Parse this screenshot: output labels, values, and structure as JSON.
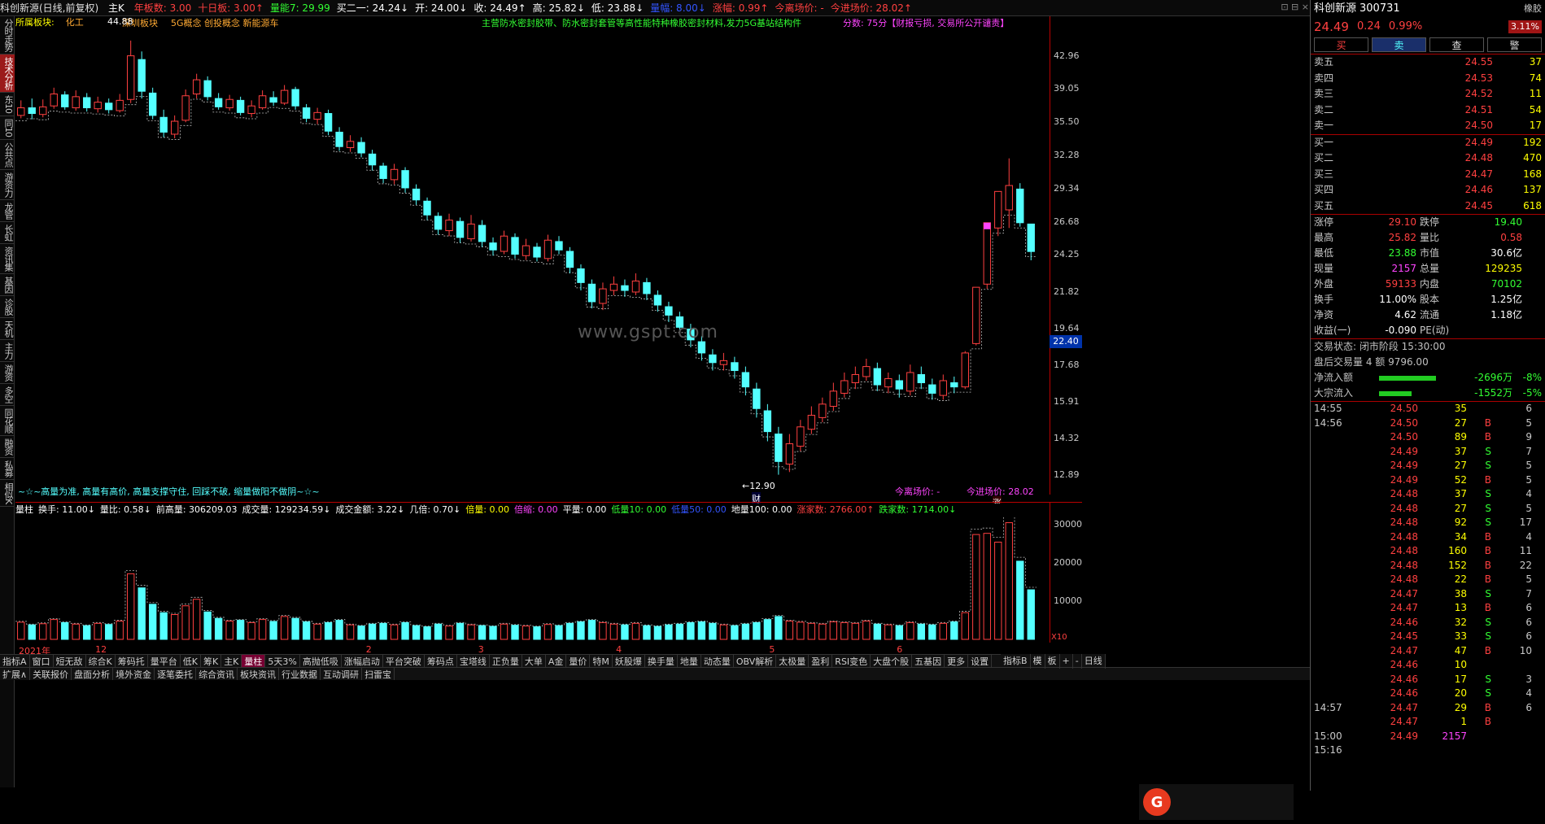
{
  "topbar": {
    "title": "科创新源(日线,前复权)",
    "main": "主K",
    "items": [
      {
        "t": "年板数: 3.00",
        "c": "red"
      },
      {
        "t": "十日板: 3.00↑",
        "c": "red"
      },
      {
        "t": "量能7: 29.99",
        "c": "grn"
      },
      {
        "t": "买二一: 24.24↓",
        "c": "white"
      },
      {
        "t": "开: 24.00↓",
        "c": "white"
      },
      {
        "t": "收: 24.49↑",
        "c": "white"
      },
      {
        "t": "高: 25.82↓",
        "c": "white"
      },
      {
        "t": "低: 23.88↓",
        "c": "white"
      },
      {
        "t": "量幅: 8.00↓",
        "c": "blue"
      },
      {
        "t": "涨幅: 0.99↑",
        "c": "red"
      },
      {
        "t": "今离场价: -",
        "c": "red"
      },
      {
        "t": "今进场价: 28.02↑",
        "c": "red"
      }
    ]
  },
  "infoline": {
    "sector_label": "所属板块:",
    "sectors": "化工",
    "sector2": "深圳板块",
    "concepts": "5G概念 创投概念 新能源车",
    "business": "主营防水密封胶带、防水密封套管等高性能特种橡胶密封材料,发力5G基站结构件",
    "score": "分数: 75分【财报亏损, 交易所公开谴责】",
    "peak_label": "44.88"
  },
  "price_ticks": [
    "42.96",
    "39.05",
    "35.50",
    "32.28",
    "29.34",
    "26.68",
    "24.25",
    "21.82",
    "19.64",
    "17.68",
    "15.91",
    "14.32",
    "12.89"
  ],
  "current_price_tag": "22.40",
  "low_label": "←12.90",
  "cai": "财",
  "zhang": "涨",
  "left_note": "~☆~高量为准, 高量有高价, 高量支撑守住, 回踩不破, 缩量做阳不做阴~☆~",
  "exit_label": "今离场价: -",
  "entry_label": "今进场价: 28.02",
  "watermark": "www.gspt.com",
  "volbar": [
    {
      "t": "量柱",
      "c": "white"
    },
    {
      "t": "换手: 11.00↓",
      "c": "white"
    },
    {
      "t": "量比: 0.58↓",
      "c": "white"
    },
    {
      "t": "前高量: 306209.03",
      "c": "white"
    },
    {
      "t": "成交量: 129234.59↓",
      "c": "white"
    },
    {
      "t": "成交金额: 3.22↓",
      "c": "white"
    },
    {
      "t": "几倍: 0.70↓",
      "c": "white"
    },
    {
      "t": "倍量: 0.00",
      "c": "yel"
    },
    {
      "t": "倍缩: 0.00",
      "c": "mag"
    },
    {
      "t": "平量: 0.00",
      "c": "white"
    },
    {
      "t": "低量10: 0.00",
      "c": "grn"
    },
    {
      "t": "低量50: 0.00",
      "c": "blue"
    },
    {
      "t": "地量100: 0.00",
      "c": "white"
    },
    {
      "t": "涨家数: 2766.00↑",
      "c": "red"
    },
    {
      "t": "跌家数: 1714.00↓",
      "c": "grn"
    }
  ],
  "vol_ticks": [
    "30000",
    "20000",
    "10000"
  ],
  "vol_unit": "X10",
  "date_axis": [
    "2021年",
    "12",
    "2",
    "3",
    "4",
    "5",
    "6"
  ],
  "left_tabs": [
    "分时走势",
    "技术分析",
    "东10",
    "同10",
    "公共点",
    "游资力",
    "龙管",
    "长虹",
    "资讯集",
    "基因",
    "诊股",
    "天机",
    "主力",
    "游资",
    "多空",
    "同花顺",
    "融资",
    "私募",
    "相似K"
  ],
  "bottom_tabs": [
    "指标A",
    "窗口",
    "短无敌",
    "综合K",
    "筹码托",
    "量平台",
    "低K",
    "筹K",
    "主K",
    "量柱",
    "5天3%",
    "高抛低吸",
    "涨幅启动",
    "平台突破",
    "筹码点",
    "宝塔线",
    "正负量",
    "大单",
    "A金",
    "量价",
    "特M",
    "妖股爆",
    "换手量",
    "地量",
    "动态量",
    "OBV解析",
    "太极量",
    "盈利",
    "RSI变色",
    "大盘个股",
    "五基因",
    "更多",
    "设置"
  ],
  "bottom_tabs2": [
    "扩展∧",
    "关联报价",
    "盘面分析",
    "境外资金",
    "逐笔委托",
    "综合资讯",
    "板块资讯",
    "行业数据",
    "互动调研",
    "扫雷宝"
  ],
  "bottom_right": [
    "指标B",
    "模",
    "板",
    "+",
    "-",
    "日线"
  ],
  "right": {
    "name": "科创新源",
    "code": "300731",
    "tag": "橡胶",
    "tag_pct": "3.11%",
    "price": "24.49",
    "chg": "0.24",
    "pct": "0.99%",
    "buttons": [
      "买",
      "卖",
      "查",
      "警"
    ],
    "asks": [
      [
        "卖五",
        "24.55",
        "37"
      ],
      [
        "卖四",
        "24.53",
        "74"
      ],
      [
        "卖三",
        "24.52",
        "11"
      ],
      [
        "卖二",
        "24.51",
        "54"
      ],
      [
        "卖一",
        "24.50",
        "17"
      ]
    ],
    "bids": [
      [
        "买一",
        "24.49",
        "192"
      ],
      [
        "买二",
        "24.48",
        "470"
      ],
      [
        "买三",
        "24.47",
        "168"
      ],
      [
        "买四",
        "24.46",
        "137"
      ],
      [
        "买五",
        "24.45",
        "618"
      ]
    ],
    "stats": [
      [
        "涨停",
        "29.10",
        "跌停",
        "19.40"
      ],
      [
        "最高",
        "25.82",
        "量比",
        "0.58"
      ],
      [
        "最低",
        "23.88",
        "市值",
        "30.6亿"
      ],
      [
        "现量",
        "2157",
        "总量",
        "129235"
      ],
      [
        "外盘",
        "59133",
        "内盘",
        "70102"
      ],
      [
        "换手",
        "11.00%",
        "股本",
        "1.25亿"
      ],
      [
        "净资",
        "4.62",
        "流通",
        "1.18亿"
      ],
      [
        "收益(一)",
        "-0.090",
        "PE(动)",
        ""
      ]
    ],
    "status": "交易状态: 闭市阶段 15:30:00",
    "after": "盘后交易量 4 额 9796.00",
    "flow1_label": "净流入额",
    "flow1_val": "-2696万",
    "flow1_pct": "-8%",
    "flow2_label": "大宗流入",
    "flow2_val": "-1552万",
    "flow2_pct": "-5%",
    "ticks": [
      [
        "14:55",
        "24.50",
        "35",
        "",
        "6"
      ],
      [
        "14:56",
        "24.50",
        "27",
        "B",
        "5"
      ],
      [
        "",
        "24.50",
        "89",
        "B",
        "9"
      ],
      [
        "",
        "24.49",
        "37",
        "S",
        "7"
      ],
      [
        "",
        "24.49",
        "27",
        "S",
        "5"
      ],
      [
        "",
        "24.49",
        "52",
        "B",
        "5"
      ],
      [
        "",
        "24.48",
        "37",
        "S",
        "4"
      ],
      [
        "",
        "24.48",
        "27",
        "S",
        "5"
      ],
      [
        "",
        "24.48",
        "92",
        "S",
        "17"
      ],
      [
        "",
        "24.48",
        "34",
        "B",
        "4"
      ],
      [
        "",
        "24.48",
        "160",
        "B",
        "11"
      ],
      [
        "",
        "24.48",
        "152",
        "B",
        "22"
      ],
      [
        "",
        "24.48",
        "22",
        "B",
        "5"
      ],
      [
        "",
        "24.47",
        "38",
        "S",
        "7"
      ],
      [
        "",
        "24.47",
        "13",
        "B",
        "6"
      ],
      [
        "",
        "24.46",
        "32",
        "S",
        "6"
      ],
      [
        "",
        "24.45",
        "33",
        "S",
        "6"
      ],
      [
        "",
        "24.47",
        "47",
        "B",
        "10"
      ],
      [
        "",
        "24.46",
        "10",
        "",
        ""
      ],
      [
        "",
        "24.46",
        "17",
        "S",
        "3"
      ],
      [
        "",
        "24.46",
        "20",
        "S",
        "4"
      ],
      [
        "14:57",
        "24.47",
        "29",
        "B",
        "6"
      ],
      [
        "",
        "24.47",
        "1",
        "B",
        ""
      ],
      [
        "15:00",
        "24.49",
        "2157",
        "",
        ""
      ],
      [
        "15:16",
        "",
        "",
        "",
        ""
      ]
    ]
  },
  "chart_data": {
    "type": "candlestick",
    "title": "科创新源(日线,前复权)",
    "note": "representative subset of daily candles (open, close, high, low)",
    "yscale": "log",
    "ylim": [
      12.3,
      45.5
    ],
    "candles": [
      [
        36.2,
        37.0,
        37.8,
        35.9
      ],
      [
        37.0,
        36.4,
        38.0,
        35.8
      ],
      [
        36.3,
        37.1,
        37.9,
        36.0
      ],
      [
        37.2,
        38.5,
        39.2,
        36.9
      ],
      [
        38.4,
        37.1,
        38.8,
        36.8
      ],
      [
        37.0,
        38.2,
        38.9,
        36.7
      ],
      [
        38.1,
        37.0,
        38.6,
        36.6
      ],
      [
        36.9,
        37.6,
        38.2,
        36.5
      ],
      [
        37.5,
        36.8,
        38.0,
        36.4
      ],
      [
        36.7,
        37.8,
        38.5,
        36.5
      ],
      [
        37.9,
        42.96,
        44.88,
        37.5
      ],
      [
        42.5,
        38.8,
        43.5,
        38.0
      ],
      [
        38.6,
        36.2,
        39.2,
        35.8
      ],
      [
        36.0,
        34.5,
        36.8,
        34.0
      ],
      [
        34.3,
        35.6,
        36.2,
        33.9
      ],
      [
        35.7,
        38.3,
        39.0,
        35.5
      ],
      [
        38.5,
        40.1,
        40.8,
        38.0
      ],
      [
        40.0,
        38.2,
        40.5,
        37.8
      ],
      [
        38.0,
        37.1,
        38.6,
        36.8
      ],
      [
        37.0,
        37.9,
        38.4,
        36.7
      ],
      [
        37.8,
        36.5,
        38.2,
        36.2
      ],
      [
        36.4,
        37.2,
        37.8,
        36.0
      ],
      [
        37.0,
        38.3,
        38.9,
        36.8
      ],
      [
        38.1,
        37.6,
        38.8,
        37.2
      ],
      [
        37.5,
        38.9,
        39.5,
        37.3
      ],
      [
        39.0,
        37.2,
        39.3,
        36.8
      ],
      [
        37.0,
        35.9,
        37.4,
        35.5
      ],
      [
        35.8,
        36.5,
        37.0,
        35.3
      ],
      [
        36.4,
        34.6,
        36.8,
        34.2
      ],
      [
        34.5,
        33.1,
        35.0,
        32.7
      ],
      [
        33.0,
        33.6,
        34.2,
        32.6
      ],
      [
        33.5,
        32.5,
        34.0,
        32.1
      ],
      [
        32.4,
        31.4,
        32.8,
        30.9
      ],
      [
        31.3,
        30.2,
        31.6,
        29.8
      ],
      [
        30.1,
        31.0,
        31.5,
        29.7
      ],
      [
        30.9,
        29.4,
        31.2,
        29.0
      ],
      [
        29.3,
        28.4,
        29.7,
        28.0
      ],
      [
        28.3,
        27.2,
        28.6,
        26.8
      ],
      [
        27.1,
        26.1,
        27.4,
        25.7
      ],
      [
        26.0,
        26.8,
        27.3,
        25.6
      ],
      [
        26.7,
        25.5,
        27.0,
        25.1
      ],
      [
        25.4,
        26.5,
        27.2,
        25.2
      ],
      [
        26.4,
        25.2,
        26.8,
        24.8
      ],
      [
        25.1,
        24.6,
        25.5,
        24.2
      ],
      [
        24.5,
        25.6,
        26.0,
        24.3
      ],
      [
        25.5,
        24.3,
        25.8,
        24.0
      ],
      [
        24.2,
        24.9,
        25.4,
        23.9
      ],
      [
        24.8,
        24.1,
        25.1,
        23.8
      ],
      [
        24.0,
        25.3,
        25.7,
        23.8
      ],
      [
        25.2,
        24.6,
        25.6,
        24.3
      ],
      [
        24.5,
        23.4,
        24.8,
        23.0
      ],
      [
        23.3,
        22.4,
        23.6,
        21.9
      ],
      [
        22.3,
        21.2,
        22.6,
        20.8
      ],
      [
        21.1,
        22.0,
        22.4,
        20.7
      ],
      [
        21.9,
        22.3,
        22.8,
        21.6
      ],
      [
        22.2,
        21.9,
        22.6,
        21.5
      ],
      [
        21.8,
        22.5,
        23.0,
        21.6
      ],
      [
        22.4,
        21.7,
        22.7,
        21.3
      ],
      [
        21.6,
        21.0,
        21.9,
        20.6
      ],
      [
        20.9,
        20.4,
        21.2,
        20.0
      ],
      [
        20.3,
        19.7,
        20.6,
        19.3
      ],
      [
        19.6,
        19.0,
        19.9,
        18.6
      ],
      [
        18.9,
        18.3,
        19.2,
        17.9
      ],
      [
        18.2,
        17.8,
        18.5,
        17.4
      ],
      [
        17.7,
        17.9,
        18.3,
        17.4
      ],
      [
        17.8,
        17.4,
        18.1,
        17.0
      ],
      [
        17.3,
        16.6,
        17.6,
        16.2
      ],
      [
        16.5,
        15.6,
        16.8,
        15.2
      ],
      [
        15.5,
        14.6,
        15.8,
        14.2
      ],
      [
        14.5,
        13.4,
        14.8,
        12.9
      ],
      [
        13.3,
        14.1,
        14.5,
        13.0
      ],
      [
        14.0,
        14.8,
        15.1,
        13.8
      ],
      [
        14.7,
        15.3,
        15.7,
        14.5
      ],
      [
        15.2,
        15.8,
        16.1,
        15.0
      ],
      [
        15.7,
        16.4,
        16.8,
        15.5
      ],
      [
        16.3,
        16.9,
        17.3,
        16.1
      ],
      [
        16.8,
        17.2,
        17.6,
        16.5
      ],
      [
        17.1,
        17.6,
        18.0,
        16.9
      ],
      [
        17.5,
        16.7,
        17.8,
        16.4
      ],
      [
        16.6,
        17.0,
        17.3,
        16.3
      ],
      [
        16.9,
        16.5,
        17.2,
        16.1
      ],
      [
        16.4,
        17.3,
        17.7,
        16.2
      ],
      [
        17.2,
        16.8,
        17.6,
        16.5
      ],
      [
        16.7,
        16.3,
        17.0,
        16.0
      ],
      [
        16.2,
        16.9,
        17.2,
        16.0
      ],
      [
        16.8,
        16.6,
        17.1,
        16.3
      ],
      [
        16.6,
        18.3,
        18.4,
        16.5
      ],
      [
        18.8,
        22.1,
        22.1,
        18.7
      ],
      [
        22.3,
        26.6,
        26.6,
        22.0
      ],
      [
        26.2,
        29.1,
        29.1,
        25.6
      ],
      [
        27.6,
        29.6,
        32.0,
        26.2
      ],
      [
        29.3,
        26.6,
        29.8,
        26.3
      ],
      [
        26.5,
        24.49,
        25.82,
        23.88
      ]
    ],
    "volumes": [
      0.45,
      0.38,
      0.41,
      0.52,
      0.44,
      0.4,
      0.36,
      0.42,
      0.39,
      0.48,
      1.72,
      1.35,
      0.92,
      0.7,
      0.65,
      0.88,
      1.05,
      0.72,
      0.55,
      0.48,
      0.5,
      0.44,
      0.52,
      0.47,
      0.6,
      0.55,
      0.46,
      0.4,
      0.44,
      0.5,
      0.38,
      0.35,
      0.4,
      0.42,
      0.38,
      0.44,
      0.36,
      0.33,
      0.4,
      0.35,
      0.42,
      0.38,
      0.36,
      0.34,
      0.4,
      0.37,
      0.35,
      0.33,
      0.39,
      0.36,
      0.42,
      0.46,
      0.5,
      0.44,
      0.4,
      0.38,
      0.42,
      0.36,
      0.34,
      0.38,
      0.4,
      0.44,
      0.46,
      0.42,
      0.38,
      0.36,
      0.4,
      0.44,
      0.52,
      0.6,
      0.48,
      0.45,
      0.42,
      0.4,
      0.46,
      0.44,
      0.42,
      0.48,
      0.4,
      0.38,
      0.36,
      0.44,
      0.4,
      0.38,
      0.42,
      0.46,
      0.7,
      2.75,
      2.78,
      2.55,
      3.06,
      2.05,
      1.3
    ],
    "vol_ylim": [
      0,
      32000
    ]
  }
}
